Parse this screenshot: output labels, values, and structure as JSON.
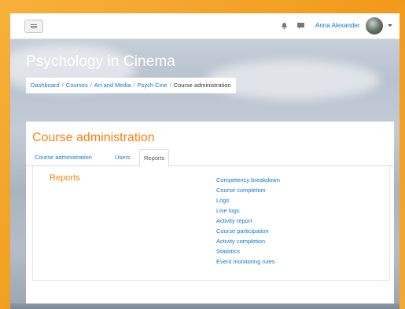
{
  "navbar": {
    "menu_button": "menu",
    "icons": [
      "bell-icon",
      "chat-icon"
    ],
    "user_name": "Anna Alexander"
  },
  "site_title": "Psychology in Cinema",
  "breadcrumb": {
    "items": [
      {
        "label": "Dashboard"
      },
      {
        "label": "Courses"
      },
      {
        "label": "Art and Media"
      },
      {
        "label": "Psych Cine"
      },
      {
        "label": "Course administration"
      }
    ],
    "separator": "/"
  },
  "page_title": "Course administration",
  "tabs": [
    {
      "label": "Course administration",
      "active": false
    },
    {
      "label": "Users",
      "active": false
    },
    {
      "label": "Reports",
      "active": true
    }
  ],
  "section_title": "Reports",
  "reports": [
    "Competency breakdown",
    "Course completion",
    "Logs",
    "Live logs",
    "Activity report",
    "Course participation",
    "Activity completion",
    "Statistics",
    "Event monitoring rules"
  ],
  "colors": {
    "accent": "#f98012",
    "link": "#1177d1",
    "frame": "#f5a623"
  }
}
